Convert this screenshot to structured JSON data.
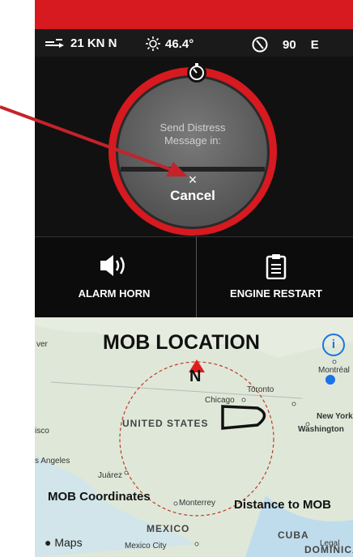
{
  "status": {
    "wind": "21 KN N",
    "temperature": "46.4°",
    "heading_value": "90",
    "heading_dir": "E"
  },
  "sos": {
    "message": "Send Distress Message in:",
    "close_glyph": "×",
    "cancel_label": "Cancel"
  },
  "actions": {
    "alarm_label": "ALARM HORN",
    "engine_label": "ENGINE RESTART"
  },
  "map": {
    "title": "MOB LOCATION",
    "north": "N",
    "info_glyph": "i",
    "places": {
      "ver": "ver",
      "chicago": "Chicago",
      "toronto": "Toronto",
      "montreal": "Montréal",
      "new_york": "New York",
      "washington": "Washington",
      "united_states": "UNITED STATES",
      "isco": "isco",
      "los_angeles": "s Angeles",
      "juarez": "Juárez",
      "monterrey": "Monterrey",
      "mexico": "MEXICO",
      "mexico_city": "Mexico City",
      "cuba": "CUBA",
      "dominica": "DOMINICA",
      "legal": "Legal"
    },
    "mob_coordinates": "MOB Coordinates",
    "distance_to_mob": "Distance to MOB",
    "maps_logo": "Maps"
  },
  "colors": {
    "brand_red": "#d71920",
    "link_blue": "#1a73e8"
  }
}
